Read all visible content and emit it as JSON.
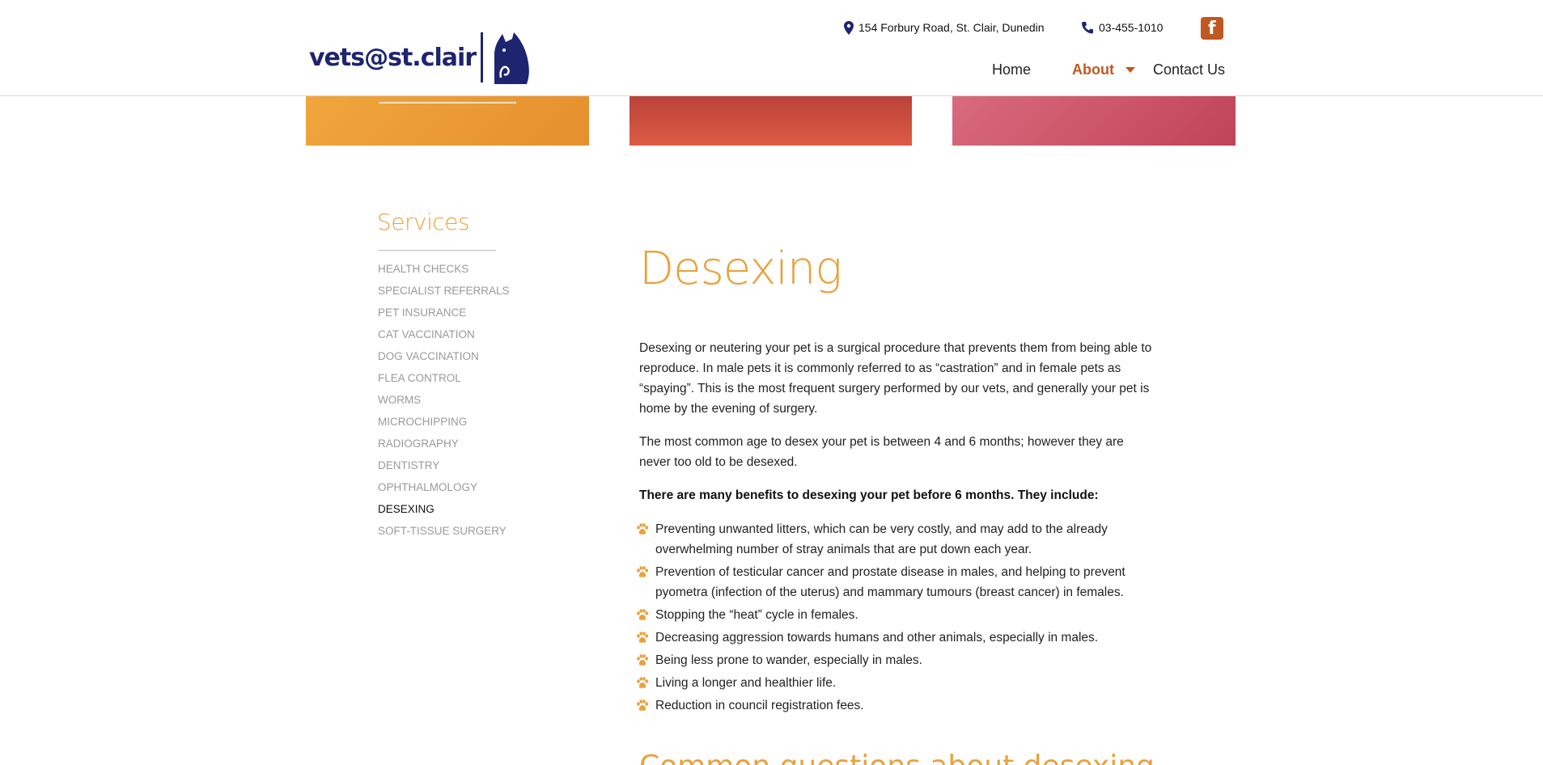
{
  "header": {
    "logo_text": "vets@st.clair",
    "address": "154 Forbury Road, St. Clair, Dunedin",
    "phone": "03-455-1010",
    "facebook_icon": "facebook-icon",
    "nav": {
      "home": "Home",
      "about": "About",
      "contact": "Contact Us"
    }
  },
  "colors": {
    "accent_orange": "#eaa13c",
    "rust": "#c0581f",
    "navy": "#1e2470"
  },
  "sidebar": {
    "title": "Services",
    "items": [
      {
        "label": "HEALTH CHECKS",
        "active": false
      },
      {
        "label": "SPECIALIST REFERRALS",
        "active": false
      },
      {
        "label": "PET INSURANCE",
        "active": false
      },
      {
        "label": "CAT VACCINATION",
        "active": false
      },
      {
        "label": "DOG VACCINATION",
        "active": false
      },
      {
        "label": "FLEA CONTROL",
        "active": false
      },
      {
        "label": "WORMS",
        "active": false
      },
      {
        "label": "MICROCHIPPING",
        "active": false
      },
      {
        "label": "RADIOGRAPHY",
        "active": false
      },
      {
        "label": "DENTISTRY",
        "active": false
      },
      {
        "label": "OPHTHALMOLOGY",
        "active": false
      },
      {
        "label": "DESEXING",
        "active": true
      },
      {
        "label": "SOFT-TISSUE SURGERY",
        "active": false
      }
    ]
  },
  "main": {
    "title": "Desexing",
    "p1": "Desexing or neutering your pet is a surgical procedure that prevents them from being able to reproduce. In male pets it is commonly referred to as “castration” and in female pets as “spaying”. This is the most frequent surgery performed by our vets, and generally your pet is home by the evening of surgery.",
    "p2": "The most common age to desex your pet is between 4 and 6 months; however they are never too old to be desexed.",
    "p3": "There are many benefits to desexing your pet before 6 months. They include:",
    "benefits": [
      "Preventing unwanted litters, which can be very costly, and may add to the already overwhelming number of stray animals that are put down each year.",
      "Prevention of testicular cancer and prostate disease in males, and helping to prevent pyometra (infection of the uterus) and mammary tumours (breast cancer) in females.",
      "Stopping the “heat” cycle in females.",
      "Decreasing aggression towards humans and other animals, especially in males.",
      "Being less prone to wander, especially in males.",
      "Living a longer and healthier life.",
      "Reduction in council registration fees."
    ],
    "next_heading": "Common questions about desexing"
  }
}
